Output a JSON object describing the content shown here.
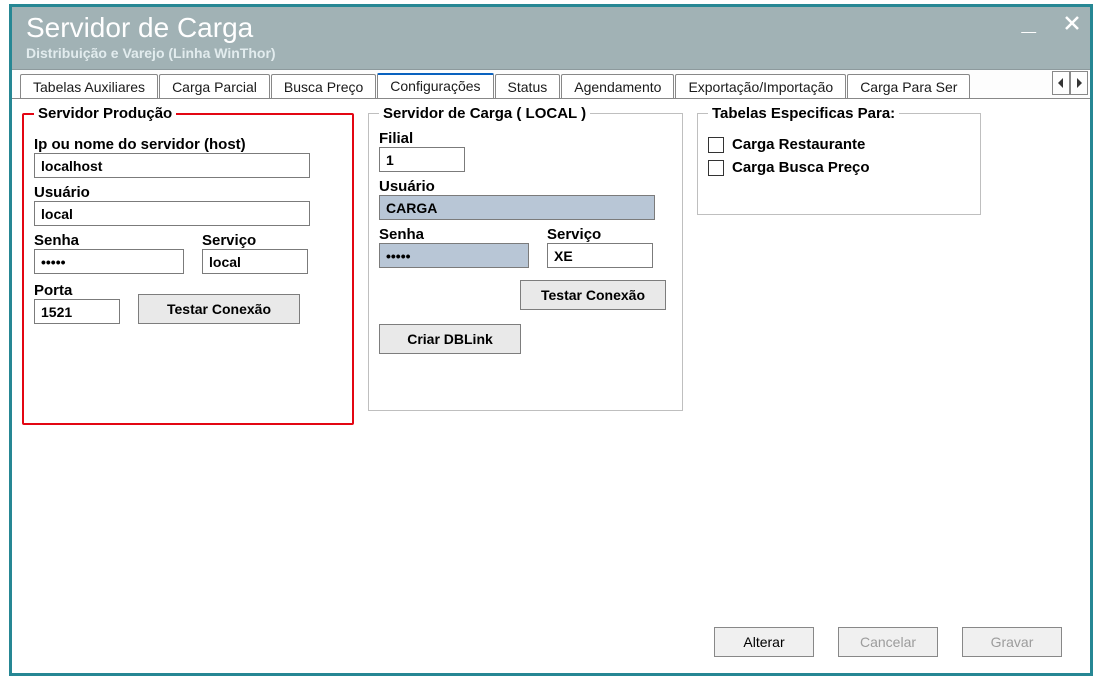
{
  "window": {
    "title": "Servidor de Carga",
    "subtitle": "Distribuição e Varejo (Linha WinThor)"
  },
  "tabs": [
    {
      "label": "Tabelas Auxiliares"
    },
    {
      "label": "Carga Parcial"
    },
    {
      "label": "Busca Preço"
    },
    {
      "label": "Configurações",
      "active": true
    },
    {
      "label": "Status"
    },
    {
      "label": "Agendamento"
    },
    {
      "label": "Exportação/Importação"
    },
    {
      "label": "Carga Para Ser"
    }
  ],
  "producao": {
    "legend": "Servidor Produção",
    "host_label": "Ip ou nome do servidor (host)",
    "host_value": "localhost",
    "user_label": "Usuário",
    "user_value": "local",
    "senha_label": "Senha",
    "senha_value": "•••••",
    "servico_label": "Serviço",
    "servico_value": "local",
    "porta_label": "Porta",
    "porta_value": "1521",
    "test_btn": "Testar Conexão"
  },
  "local": {
    "legend": "Servidor de Carga ( LOCAL )",
    "filial_label": "Filial",
    "filial_value": "1",
    "user_label": "Usuário",
    "user_value": "CARGA",
    "senha_label": "Senha",
    "senha_value": "•••••",
    "servico_label": "Serviço",
    "servico_value": "XE",
    "test_btn": "Testar Conexão",
    "dblink_btn": "Criar DBLink"
  },
  "especificas": {
    "legend": "Tabelas Especificas Para:",
    "opt1": "Carga Restaurante",
    "opt2": "Carga Busca Preço"
  },
  "footer": {
    "alterar": "Alterar",
    "cancelar": "Cancelar",
    "gravar": "Gravar"
  }
}
